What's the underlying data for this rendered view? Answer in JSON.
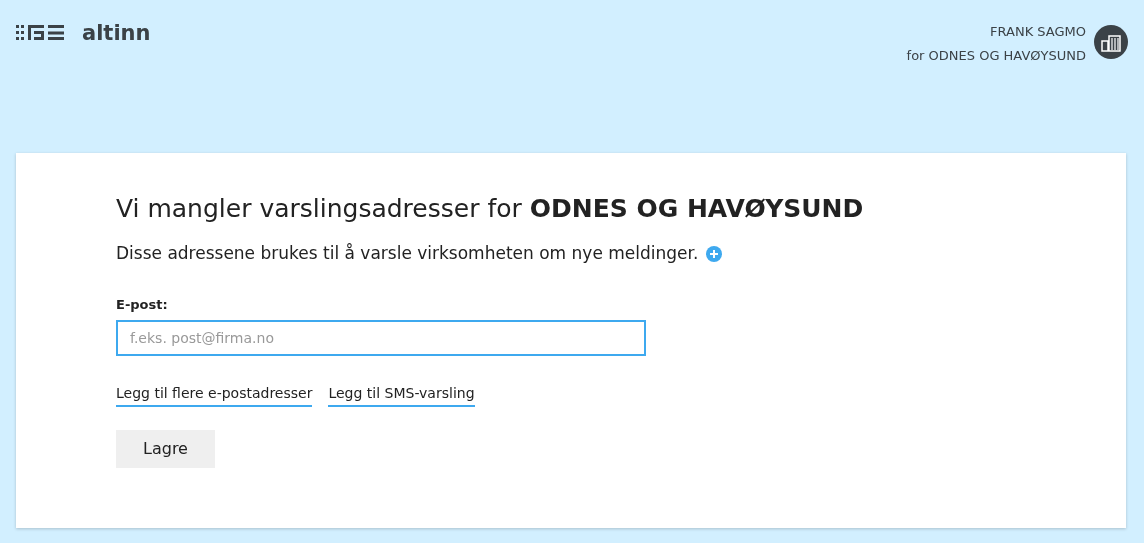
{
  "header": {
    "logo_text": "altinn",
    "user_name": "FRANK SAGMO",
    "user_org": "for ODNES OG HAVØYSUND"
  },
  "card": {
    "title": "Vi mangler varslingsadresser for **ODNES OG HAVØYSUND**",
    "description": "Disse adressene brukes til å varsle virksomheten om nye meldinger.",
    "email_label": "E-post:",
    "email_field": {
      "placeholder": "f.eks. post@firma.no"
    },
    "links": [
      "Legg til flere e-postadresser",
      "Legg til SMS-varsling"
    ],
    "save_button": "Lagre"
  }
}
